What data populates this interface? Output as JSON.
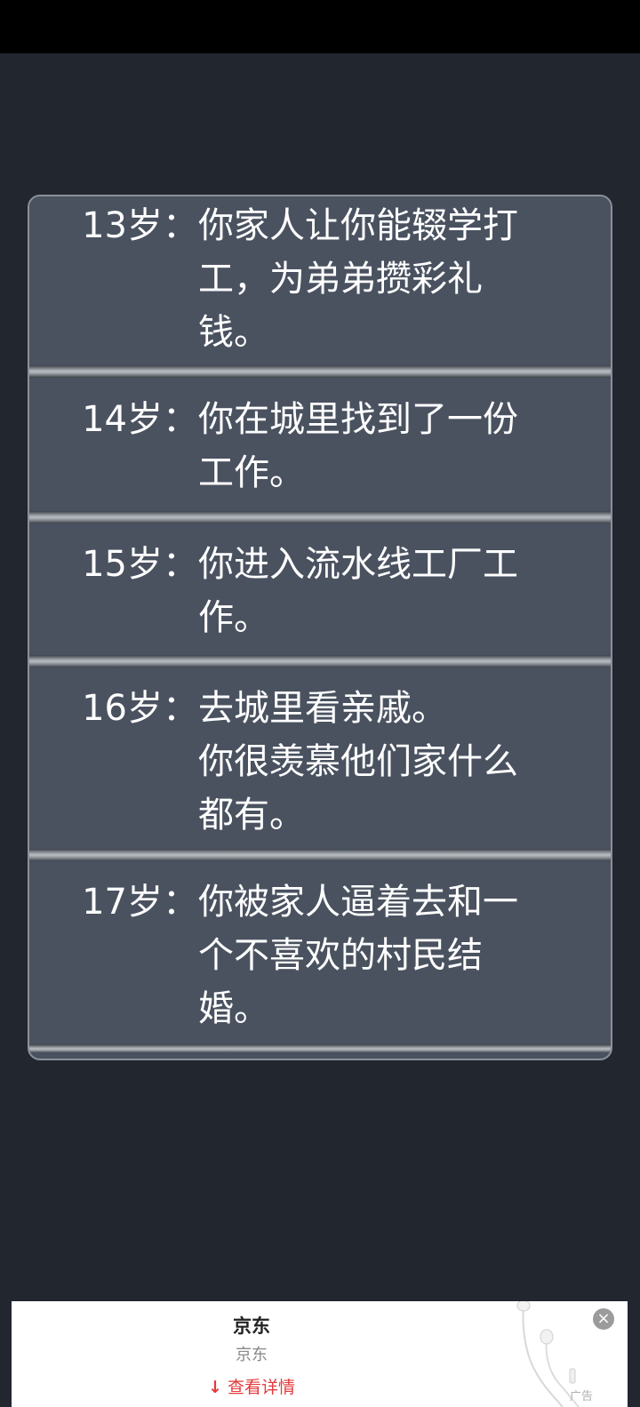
{
  "entries": [
    {
      "age": "13岁：",
      "text": "你家人让你能辍学打\n工，为弟弟攒彩礼\n钱。"
    },
    {
      "age": "14岁：",
      "text": "你在城里找到了一份\n工作。"
    },
    {
      "age": "15岁：",
      "text": "你进入流水线工厂工\n作。"
    },
    {
      "age": "16岁：",
      "text": "去城里看亲戚。\n你很羡慕他们家什么\n都有。"
    },
    {
      "age": "17岁：",
      "text": "你被家人逼着去和一\n个不喜欢的村民结\n婚。"
    }
  ],
  "ad": {
    "title": "京东",
    "subtitle": "京东",
    "link_label": "查看详情",
    "link_icon": "download-arrow-icon",
    "badge": "广告",
    "close_icon": "close-icon",
    "image": "earphones-product-image"
  },
  "colors": {
    "background": "#21262f",
    "panel": "#4a5260",
    "text": "#ffffff",
    "ad_link": "#e33a3a"
  }
}
